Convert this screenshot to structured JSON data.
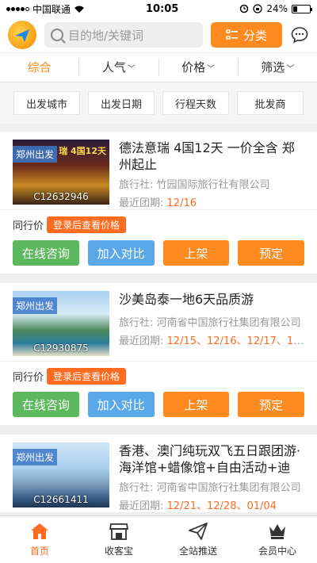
{
  "status_bar": {
    "carrier": "中国联通",
    "time": "10:05",
    "battery": "24%",
    "battery_level": 0.24
  },
  "header": {
    "search_placeholder": "目的地/关键词",
    "category_button": "分类"
  },
  "sort_tabs": [
    {
      "label": "综合",
      "caret": false
    },
    {
      "label": "人气",
      "caret": true
    },
    {
      "label": "价格",
      "caret": true
    },
    {
      "label": "筛选",
      "caret": true
    }
  ],
  "filters": [
    "出发城市",
    "出发日期",
    "行程天数",
    "批发商"
  ],
  "products": [
    {
      "origin": "郑州出发",
      "code": "C12632946",
      "banner": "瑞 4国12天",
      "title": "德法意瑞 4国12天 一价全含 郑州起止",
      "agency_label": "旅行社:",
      "agency": "竹园国际旅行社有限公司",
      "recent_label": "最近团期:",
      "recent_dates": "12/16",
      "price_label": "同行价",
      "price_tag": "登录后查看价格",
      "buttons": [
        "在线咨询",
        "加入对比",
        "上架",
        "预定"
      ]
    },
    {
      "origin": "郑州出发",
      "code": "C12930875",
      "banner": "",
      "title": "沙美岛泰一地6天品质游",
      "agency_label": "旅行社:",
      "agency": "河南省中国旅行社集团有限公司",
      "recent_label": "最近团期:",
      "recent_dates": "12/15、12/16、12/17、12/…",
      "price_label": "同行价",
      "price_tag": "登录后查看价格",
      "buttons": [
        "在线咨询",
        "加入对比",
        "上架",
        "预定"
      ]
    },
    {
      "origin": "郑州出发",
      "code": "C12661411",
      "banner": "",
      "title": "香港、澳门纯玩双飞五日跟团游·海洋馆+蜡像馆+自由活动+迪斯…",
      "agency_label": "旅行社:",
      "agency": "河南省中国旅行社集团有限公司",
      "recent_label": "最近团期:",
      "recent_dates": "12/21、12/28、01/04",
      "price_label": "",
      "price_tag": "",
      "buttons": []
    }
  ],
  "tabbar": [
    {
      "label": "首页",
      "icon": "home-icon",
      "active": true
    },
    {
      "label": "收客宝",
      "icon": "store-icon",
      "active": false
    },
    {
      "label": "全站推送",
      "icon": "send-icon",
      "active": false
    },
    {
      "label": "会员中心",
      "icon": "crown-icon",
      "active": false
    }
  ],
  "colors": {
    "accent": "#ff8a1f",
    "green": "#5cb85c",
    "blue": "#5aa8e8",
    "date": "#ff6b1f"
  }
}
